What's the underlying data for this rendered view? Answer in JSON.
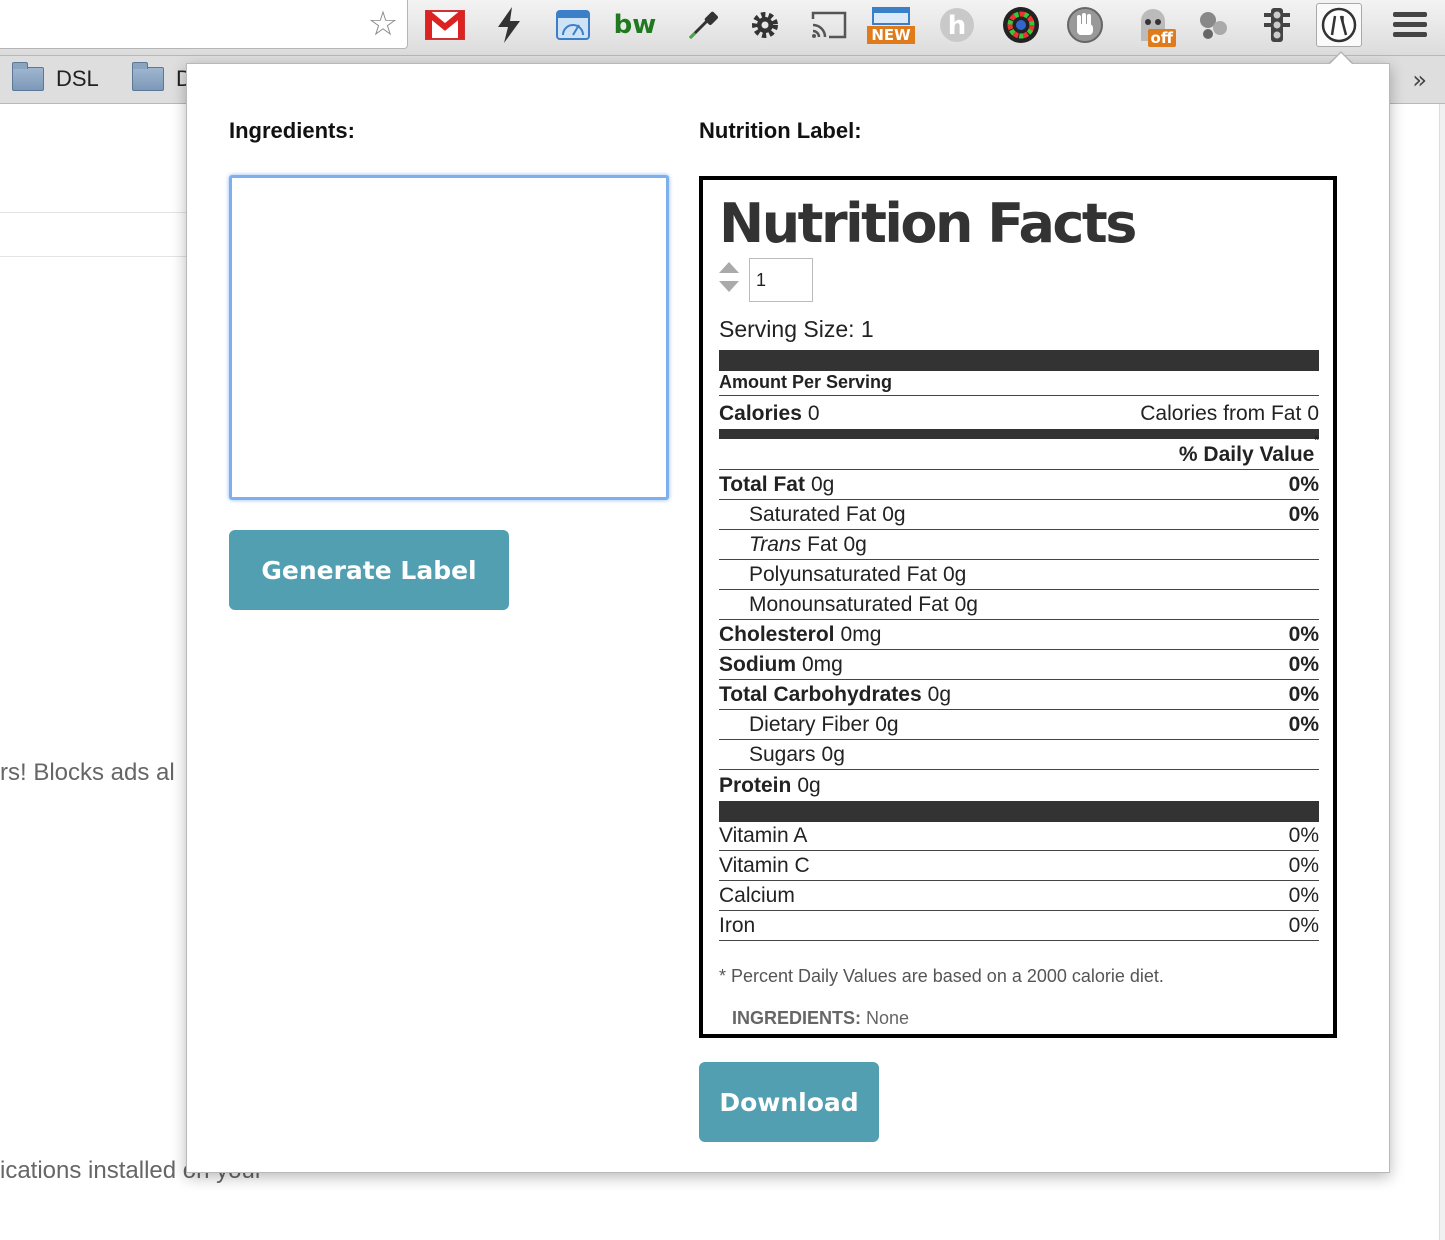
{
  "bookmarks": {
    "items": [
      {
        "label": "DSL"
      },
      {
        "label": "D"
      }
    ],
    "more": "»"
  },
  "background": {
    "text_a": "rs! Blocks ads al",
    "text_b": "ications installed on your"
  },
  "extensions": {
    "new_badge": "NEW",
    "off_badge": "off",
    "bw_label": "bw"
  },
  "popup": {
    "ingredients_heading": "Ingredients:",
    "label_heading": "Nutrition Label:",
    "ingredients_value": "",
    "generate_button": "Generate Label",
    "download_button": "Download"
  },
  "label": {
    "title": "Nutrition Facts",
    "servings_value": "1",
    "serving_size_label": "Serving Size:",
    "serving_size_value": "1",
    "amount_per_serving": "Amount Per Serving",
    "calories_label": "Calories",
    "calories_value": "0",
    "calories_from_fat_label": "Calories from Fat",
    "calories_from_fat_value": "0",
    "daily_value_header": "% Daily Value",
    "daily_value_star": "*",
    "nutrients": [
      {
        "name": "Total Fat",
        "amount": "0g",
        "dv": "0%"
      },
      {
        "name": "Saturated Fat",
        "amount": "0g",
        "dv": "0%"
      },
      {
        "name_italic": "Trans",
        "name_rest": "Fat",
        "amount": "0g"
      },
      {
        "name": "Polyunsaturated Fat",
        "amount": "0g"
      },
      {
        "name": "Monounsaturated Fat",
        "amount": "0g"
      },
      {
        "name": "Cholesterol",
        "amount": "0mg",
        "dv": "0%"
      },
      {
        "name": "Sodium",
        "amount": "0mg",
        "dv": "0%"
      },
      {
        "name": "Total Carbohydrates",
        "amount": "0g",
        "dv": "0%"
      },
      {
        "name": "Dietary Fiber",
        "amount": "0g",
        "dv": "0%"
      },
      {
        "name": "Sugars",
        "amount": "0g"
      },
      {
        "name": "Protein",
        "amount": "0g"
      }
    ],
    "vitamins": [
      {
        "name": "Vitamin A",
        "dv": "0%"
      },
      {
        "name": "Vitamin C",
        "dv": "0%"
      },
      {
        "name": "Calcium",
        "dv": "0%"
      },
      {
        "name": "Iron",
        "dv": "0%"
      }
    ],
    "footnote": "* Percent Daily Values are based on a 2000 calorie diet.",
    "ingredients_label": "INGREDIENTS:",
    "ingredients_value": "None"
  }
}
